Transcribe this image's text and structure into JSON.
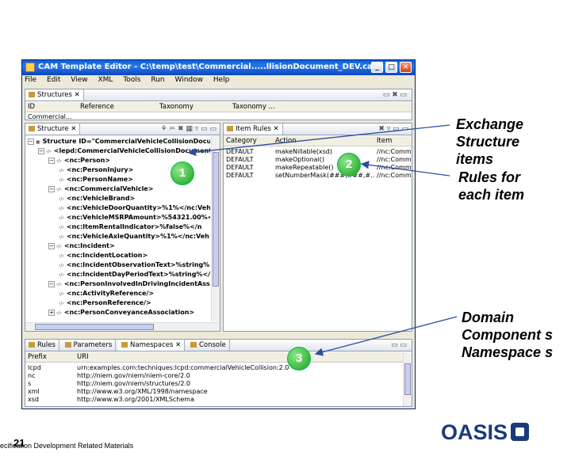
{
  "window": {
    "title": "CAM Template Editor - C:\\temp\\test\\Commercial.....llisionDocument_DEV.cam",
    "buttons": {
      "minimize": "_",
      "maximize": "□",
      "close": "✕"
    }
  },
  "menubar": [
    "File",
    "Edit",
    "View",
    "XML",
    "Tools",
    "Run",
    "Window",
    "Help"
  ],
  "structures_view": {
    "tab": "Structures",
    "columns": [
      "ID",
      "Reference",
      "Taxonomy",
      "Taxonomy ..."
    ],
    "row": "Commercial..."
  },
  "structure_view": {
    "tab": "Structure",
    "rows": [
      "Structure ID=\"CommercialVehicleCollisionDocument\" t",
      "<lepd:CommercialVehicleCollisionDocument>",
      "<nc:Person>",
      "<nc:PersonInjury>",
      "<nc:PersonName>",
      "<nc:CommercialVehicle>",
      "<nc:VehicleBrand>",
      "<nc:VehicleDoorQuantity>%1%</nc:Vehi",
      "<nc:VehicleMSRPAmount>%54321.00%<",
      "<nc:ItemRentalIndicator>%false%</n",
      "<nc:VehicleAxleQuantity>%1%</nc:Veh",
      "<nc:Incident>",
      "<nc:IncidentLocation>",
      "<nc:IncidentObservationText>%string%<",
      "<nc:IncidentDayPeriodText>%string%</",
      "<nc:PersonInvolvedInDrivingIncidentAssocia",
      "<nc:ActivityReference/>",
      "<nc:PersonReference/>",
      "<nc:PersonConveyanceAssociation>"
    ]
  },
  "item_rules_view": {
    "tab": "Item Rules",
    "columns": [
      "Category",
      "Action",
      "Item"
    ],
    "rows": [
      [
        "DEFAULT",
        "makeNillable(xsd)",
        "//nc:Comm"
      ],
      [
        "DEFAULT",
        "makeOptional()",
        "//nc:Comm"
      ],
      [
        "DEFAULT",
        "makeRepeatable()",
        "//nc:Comm"
      ],
      [
        "DEFAULT",
        "setNumberMask(###,###,#...",
        "//nc:Comm"
      ]
    ]
  },
  "bottom_view": {
    "tabs": [
      "Rules",
      "Parameters",
      "Namespaces",
      "Console"
    ],
    "columns": [
      "Prefix",
      "URI"
    ],
    "rows": [
      [
        "lcpd",
        "urn:examples.com:techniques:lcpd:commercialVehicleCollision:2.0"
      ],
      [
        "nc",
        "http://niem.gov/niem/niem-core/2.0"
      ],
      [
        "s",
        "http://niem.gov/niem/structures/2.0"
      ],
      [
        "xml",
        "http://www.w3.org/XML/1998/namespace"
      ],
      [
        "xsd",
        "http://www.w3.org/2001/XMLSchema"
      ]
    ]
  },
  "callouts": [
    "1",
    "2",
    "3"
  ],
  "annotations": {
    "exchange": "Exchange Structure items",
    "rules": "Rules for each item",
    "domain": "Domain Component s Namespace s"
  },
  "footer": "ecification Development Related Materials",
  "slide_number": "21",
  "logo": "OASIS",
  "colors": {
    "callout": "#1a9e1a",
    "titlebar": "#0a5fd8",
    "logo": "#1a3a7a"
  }
}
